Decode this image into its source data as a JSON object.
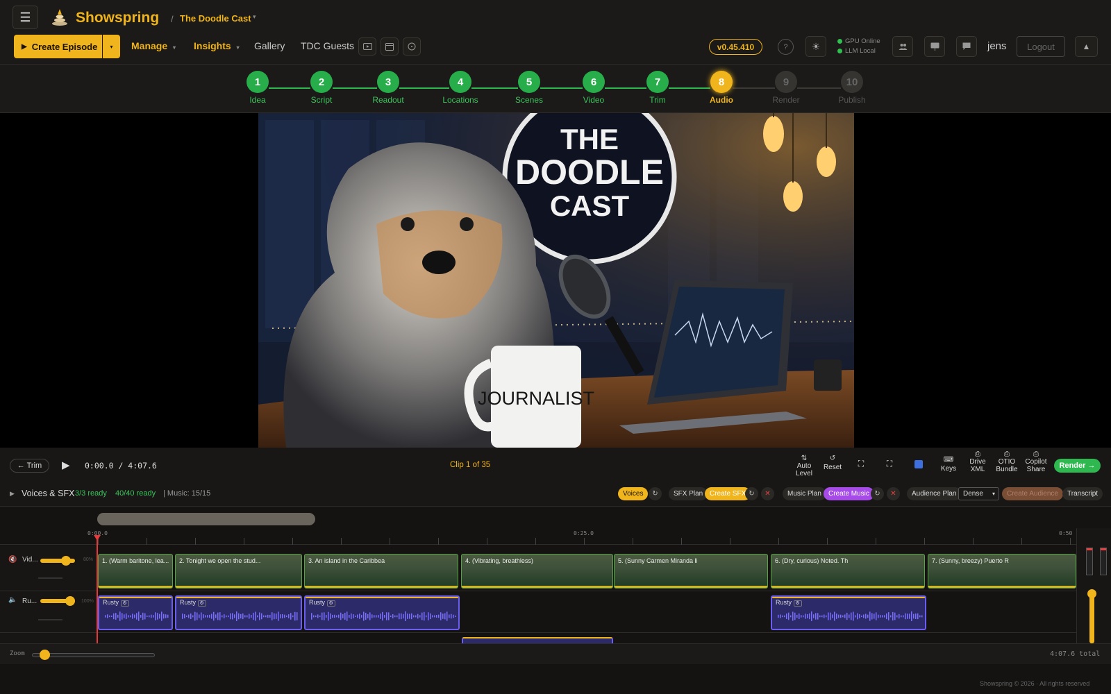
{
  "app": {
    "brand": "Showspring",
    "project": "The Doodle Cast",
    "version": "v0.45.410",
    "user": "jens",
    "logout": "Logout"
  },
  "status": {
    "gpu": "GPU Online",
    "llm": "LLM Local"
  },
  "nav": {
    "create_episode": "Create Episode",
    "manage": "Manage",
    "insights": "Insights",
    "gallery": "Gallery",
    "guests": "TDC Guests"
  },
  "steps": [
    {
      "n": "1",
      "label": "Idea",
      "state": "done"
    },
    {
      "n": "2",
      "label": "Script",
      "state": "done"
    },
    {
      "n": "3",
      "label": "Readout",
      "state": "done"
    },
    {
      "n": "4",
      "label": "Locations",
      "state": "done"
    },
    {
      "n": "5",
      "label": "Scenes",
      "state": "done"
    },
    {
      "n": "6",
      "label": "Video",
      "state": "done"
    },
    {
      "n": "7",
      "label": "Trim",
      "state": "done"
    },
    {
      "n": "8",
      "label": "Audio",
      "state": "active"
    },
    {
      "n": "9",
      "label": "Render",
      "state": "todo"
    },
    {
      "n": "10",
      "label": "Publish",
      "state": "todo"
    }
  ],
  "preview": {
    "sign_line1": "THE",
    "sign_line2": "DOODLE",
    "sign_line3": "CAST",
    "mug_text": "JOURNALIST"
  },
  "player": {
    "back": "← Trim",
    "time": "0:00.0 / 4:07.6",
    "clip": "Clip 1 of 35"
  },
  "tools": {
    "auto_level": "Auto Level",
    "reset": "Reset",
    "keys": "Keys",
    "drive_xml": "Drive XML",
    "otio": "OTIO Bundle",
    "copilot": "Copilot Share",
    "render": "Render →"
  },
  "voices": {
    "title": "Voices & SFX",
    "ready1": "3/3 ready",
    "ready2": "40/40 ready",
    "music": "| Music: 15/15",
    "voices_btn": "Voices",
    "sfx_plan": "SFX Plan",
    "create_sfx": "Create SFX",
    "music_plan": "Music Plan",
    "create_music": "Create Music",
    "audience_plan": "Audience Plan",
    "density": "Dense",
    "create_audience": "Create Audience",
    "transcript": "Transcript"
  },
  "timeline": {
    "ruler": [
      "0:00.0",
      "0:25.0",
      "0:50"
    ],
    "tracks": [
      {
        "name": "Vid...",
        "pct": "80%"
      },
      {
        "name": "Ru...",
        "pct": "100%"
      }
    ],
    "video_clips": [
      "1. (Warm baritone, lea...",
      "2. Tonight we open the stud...",
      "3. An island in the Caribbea",
      "4. (Vibrating, breathless)",
      "5. (Sunny Carmen Miranda li",
      "6. (Dry, curious) Noted. Th",
      "7. (Sunny, breezy) Puerto R"
    ],
    "audio_clips": [
      "Rusty",
      "Rusty",
      "Rusty",
      "Rusty"
    ]
  },
  "zoom": {
    "label": "Zoom",
    "total": "4:07.6 total"
  },
  "footer": "Showspring © 2026 · All rights reserved"
}
